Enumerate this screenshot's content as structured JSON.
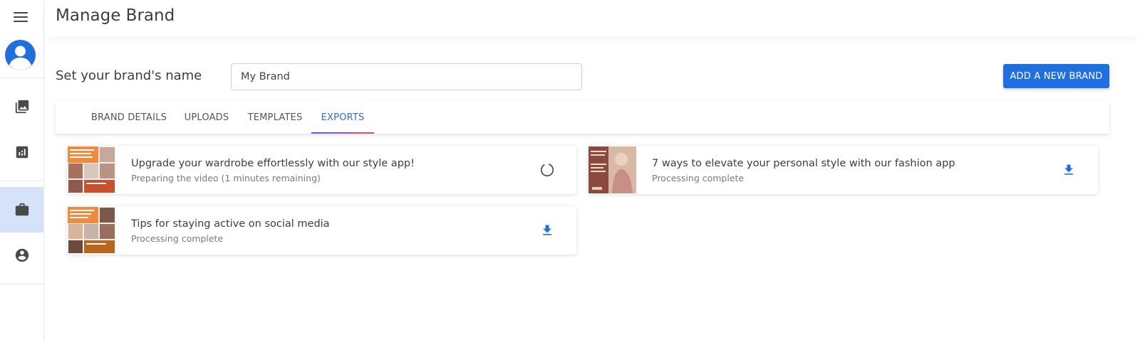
{
  "header": {
    "title": "Manage Brand"
  },
  "sidebar": {
    "items": [
      {
        "icon": "photo-library-icon"
      },
      {
        "icon": "analytics-icon"
      },
      {
        "icon": "briefcase-icon",
        "active": true
      },
      {
        "icon": "account-circle-icon"
      }
    ]
  },
  "brand": {
    "label": "Set your brand's name",
    "name_value": "My Brand",
    "add_button": "ADD A NEW BRAND"
  },
  "tabs": [
    {
      "label": "BRAND DETAILS"
    },
    {
      "label": "UPLOADS"
    },
    {
      "label": "TEMPLATES"
    },
    {
      "label": "EXPORTS",
      "active": true
    }
  ],
  "exports": [
    {
      "title": "Upgrade your wardrobe effortlessly with our style app!",
      "status": "Preparing the video (1 minutes remaining)",
      "action": "loading-spinner-icon"
    },
    {
      "title": "7 ways to elevate your personal style with our fashion app",
      "status": "Processing complete",
      "action": "download-icon"
    },
    {
      "title": "Tips for staying active on social media",
      "status": "Processing complete",
      "action": "download-icon"
    }
  ],
  "colors": {
    "primary": "#1f6fe0",
    "active_nav_bg": "#d6e2fa",
    "tab_active": "#2f6ad8"
  }
}
